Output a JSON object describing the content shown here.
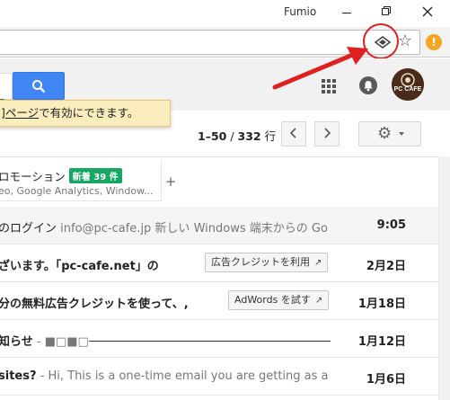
{
  "window": {
    "profile_name": "Fumio"
  },
  "browser": {
    "ext_orange_label": "!"
  },
  "header": {
    "avatar_label": "PC CAFE"
  },
  "notice": {
    "link_text": "]ページ",
    "rest_text": "で有効にできます。"
  },
  "pager": {
    "range": "1–50",
    "of": " / ",
    "total": "332",
    "unit": " 行"
  },
  "tab": {
    "title": "ロモーション",
    "badge": "新着 39 件",
    "snippet": "eo, Google Analytics, Window..."
  },
  "emails": [
    {
      "subject": "のログイン",
      "snippet": " info@pc-cafe.jp 新しい Windows 端末からの Go",
      "date": "9:05",
      "read": true
    },
    {
      "subject": "ざいます。「pc-cafe.net」の",
      "snippet": "",
      "date": "2月2日",
      "read": false,
      "chip": "広告クレジットを利用"
    },
    {
      "subject": "分の無料広告クレジットを使って、,",
      "snippet": "",
      "date": "1月18日",
      "read": false,
      "chip": "AdWords を試す"
    },
    {
      "subject": "知らせ",
      "snippet": " - ■□■□",
      "date": "1月12日",
      "read": false,
      "line": true
    },
    {
      "subject": "sites?",
      "snippet": " - Hi, This is a one-time email you are getting as a for",
      "date": "1月6日",
      "read": false
    }
  ],
  "colors": {
    "accent_blue": "#4285f4",
    "badge_green": "#16a765",
    "annotation_red": "#e02020",
    "notice_yellow": "#f9edbe"
  }
}
